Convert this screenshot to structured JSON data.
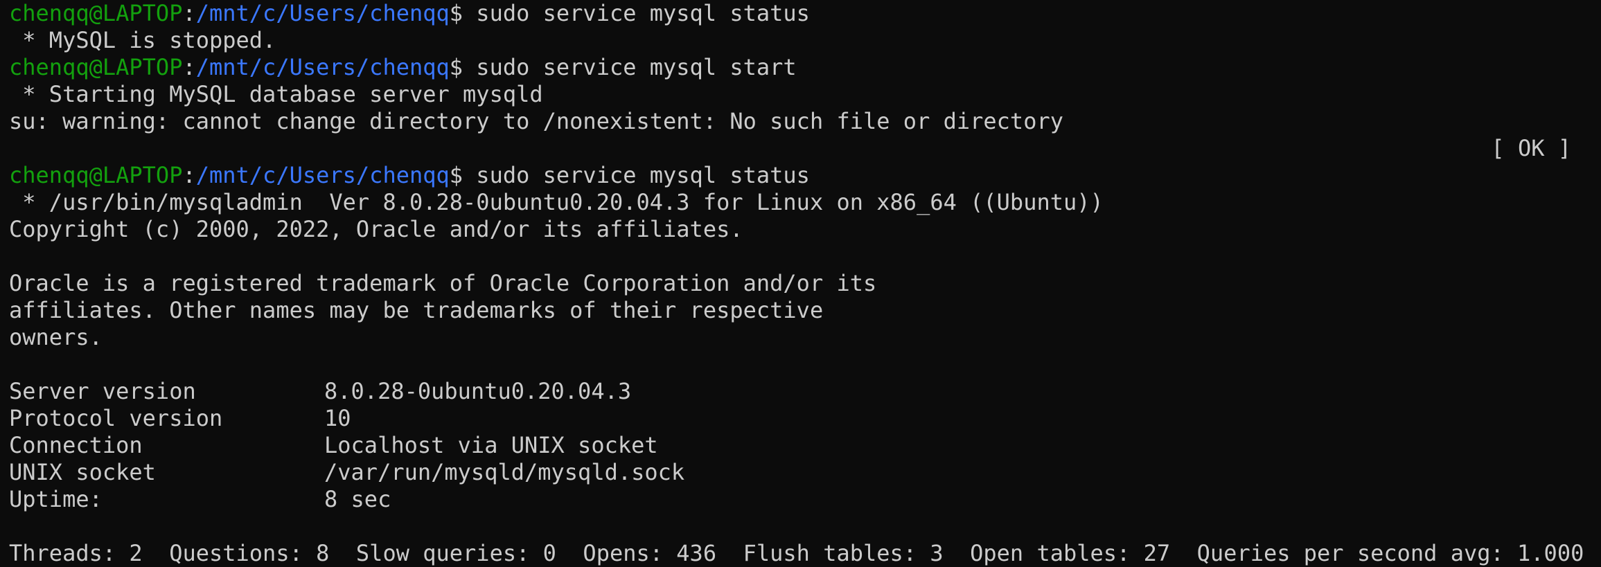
{
  "colors": {
    "background": "#0c0c0c",
    "foreground": "#cccccc",
    "user_host": "#13a10e",
    "cwd": "#3b78ff"
  },
  "prompt": {
    "user_host": "chenqq@LAPTOP",
    "separator": ":",
    "cwd": "/mnt/c/Users/chenqq",
    "symbol": "$"
  },
  "commands": [
    " sudo service mysql status",
    " sudo service mysql start",
    " sudo service mysql status"
  ],
  "output": {
    "stopped": " * MySQL is stopped.",
    "starting": " * Starting MySQL database server mysqld",
    "su_warning": "su: warning: cannot change directory to /nonexistent: No such file or directory",
    "ok": "[ OK ]",
    "admin_version": " * /usr/bin/mysqladmin  Ver 8.0.28-0ubuntu0.20.04.3 for Linux on x86_64 ((Ubuntu))",
    "copyright": "Copyright (c) 2000, 2022, Oracle and/or its affiliates.",
    "trademark_1": "Oracle is a registered trademark of Oracle Corporation and/or its",
    "trademark_2": "affiliates. Other names may be trademarks of their respective",
    "trademark_3": "owners.",
    "status_rows": [
      {
        "key": "Server version",
        "value": "8.0.28-0ubuntu0.20.04.3"
      },
      {
        "key": "Protocol version",
        "value": "10"
      },
      {
        "key": "Connection",
        "value": "Localhost via UNIX socket"
      },
      {
        "key": "UNIX socket",
        "value": "/var/run/mysqld/mysqld.sock"
      },
      {
        "key": "Uptime:",
        "value": "8 sec"
      }
    ],
    "threads_line": "Threads: 2  Questions: 8  Slow queries: 0  Opens: 436  Flush tables: 3  Open tables: 27  Queries per second avg: 1.000"
  }
}
